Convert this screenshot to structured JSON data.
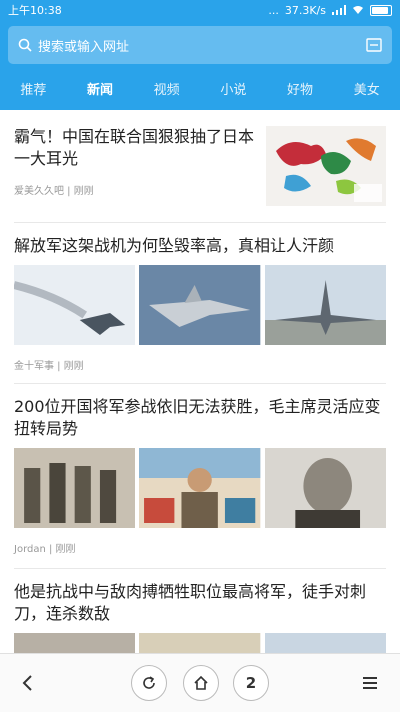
{
  "status": {
    "time": "上午10:38",
    "dots": "...",
    "speed": "37.3K/s"
  },
  "search": {
    "placeholder": "搜索或输入网址"
  },
  "tabs": [
    {
      "label": "推荐"
    },
    {
      "label": "新闻"
    },
    {
      "label": "视频"
    },
    {
      "label": "小说"
    },
    {
      "label": "好物"
    },
    {
      "label": "美女"
    }
  ],
  "feed": [
    {
      "title": "霸气！中国在联合国狠狠抽了日本一大耳光",
      "source": "爱美久久吧 | 刚刚"
    },
    {
      "title": "解放军这架战机为何坠毁率高，真相让人汗颜",
      "source": "金十军事 | 刚刚"
    },
    {
      "title": "200位开国将军参战依旧无法获胜，毛主席灵活应变扭转局势",
      "source": "Jordan | 刚刚"
    },
    {
      "title": "他是抗战中与敌肉搏牺牲职位最高将军，徒手对刺刀，连杀数敌"
    }
  ],
  "bottom": {
    "tab_count": "2"
  }
}
